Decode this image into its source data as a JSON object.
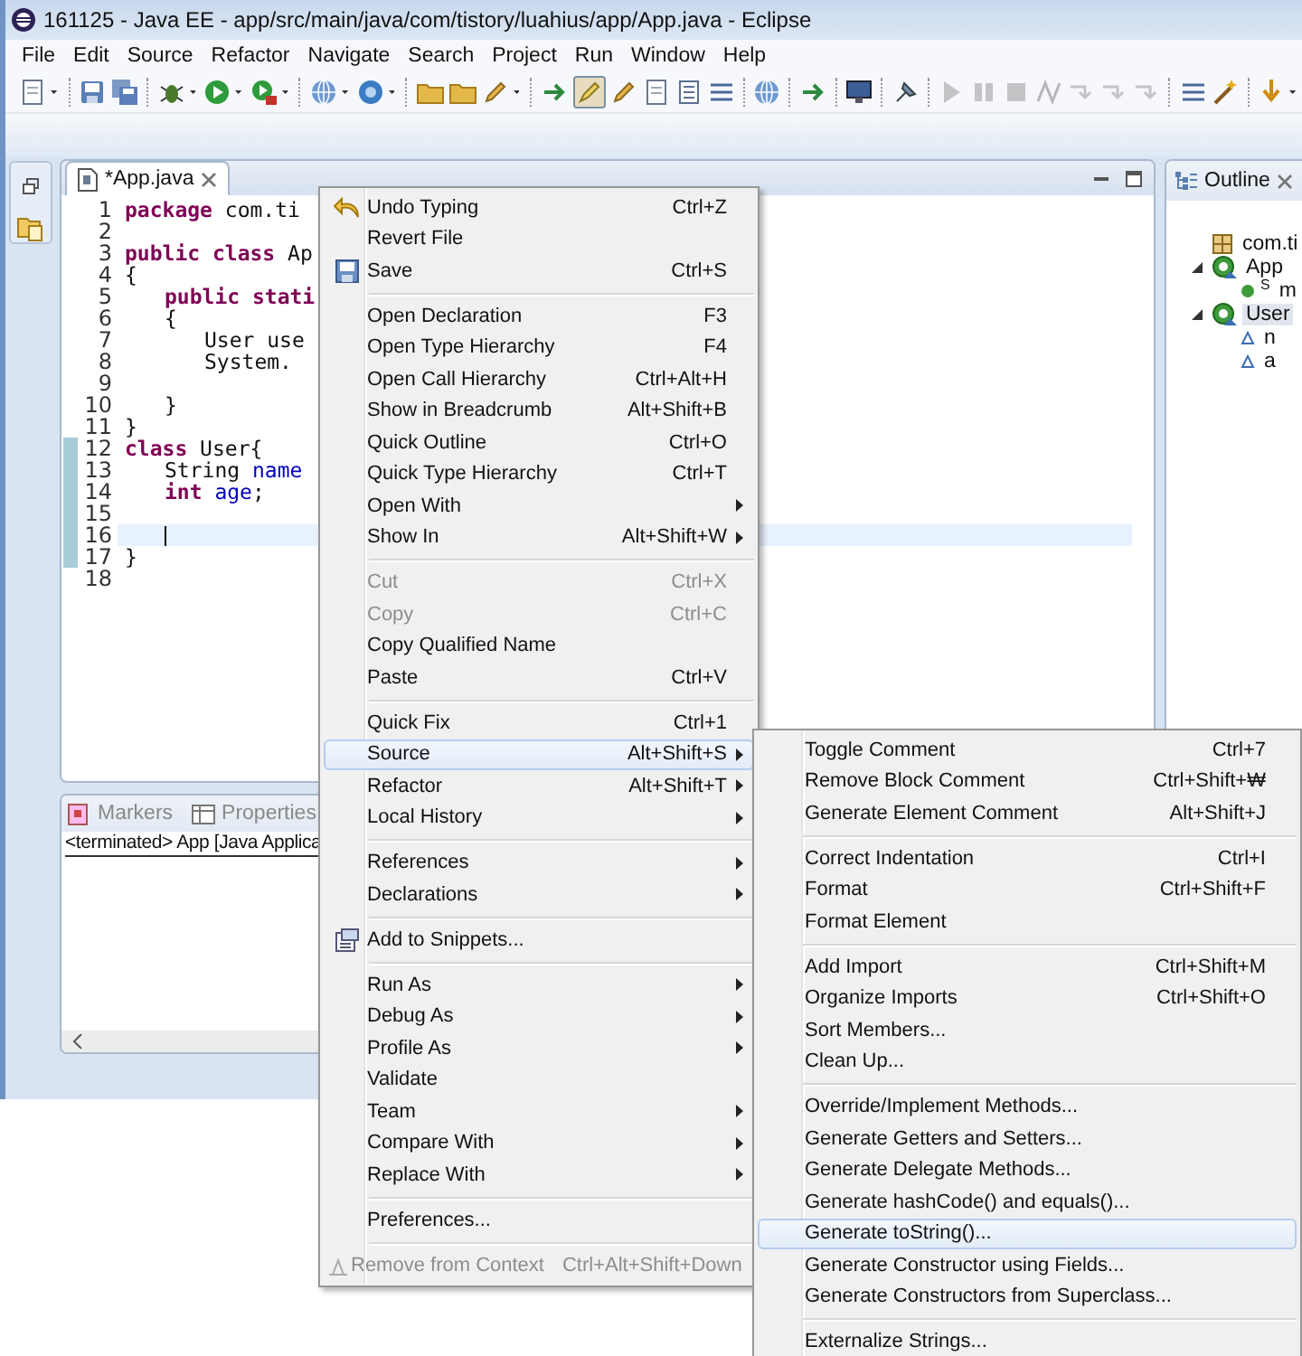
{
  "window": {
    "title": "161125 - Java EE - app/src/main/java/com/tistory/luahius/app/App.java - Eclipse"
  },
  "menubar": [
    "File",
    "Edit",
    "Source",
    "Refactor",
    "Navigate",
    "Search",
    "Project",
    "Run",
    "Window",
    "Help"
  ],
  "toolbar": [
    {
      "pressed": false,
      "disabled": false
    },
    {
      "pressed": false,
      "disabled": false
    },
    {
      "pressed": false,
      "disabled": false
    },
    {
      "pressed": false,
      "disabled": false
    },
    {
      "pressed": false,
      "disabled": false
    },
    {
      "pressed": false,
      "disabled": false
    },
    {
      "pressed": false,
      "disabled": false
    },
    {
      "pressed": false,
      "disabled": false
    },
    {
      "pressed": false,
      "disabled": false
    },
    {
      "pressed": false,
      "disabled": false
    },
    {
      "pressed": false,
      "disabled": false
    },
    {
      "pressed": false,
      "disabled": false
    },
    {
      "pressed": true,
      "disabled": false
    },
    {
      "pressed": false,
      "disabled": false
    },
    {
      "pressed": false,
      "disabled": false
    },
    {
      "pressed": false,
      "disabled": false
    },
    {
      "pressed": false,
      "disabled": false
    },
    {
      "pressed": false,
      "disabled": false
    },
    {
      "pressed": false,
      "disabled": false
    },
    {
      "pressed": false,
      "disabled": false
    },
    {
      "pressed": false,
      "disabled": false
    },
    {
      "pressed": false,
      "disabled": true
    },
    {
      "pressed": false,
      "disabled": true
    },
    {
      "pressed": false,
      "disabled": true
    },
    {
      "pressed": false,
      "disabled": true
    },
    {
      "pressed": false,
      "disabled": true
    },
    {
      "pressed": false,
      "disabled": true
    },
    {
      "pressed": false,
      "disabled": true
    },
    {
      "pressed": false,
      "disabled": false
    },
    {
      "pressed": false,
      "disabled": false
    },
    {
      "pressed": false,
      "disabled": false
    }
  ],
  "editor": {
    "tab": {
      "label": "*App.java",
      "selected": true
    },
    "lines": [
      {
        "number": "1",
        "changed": false,
        "current": false,
        "tokens": [
          {
            "text": "package",
            "kind": "keyword"
          },
          {
            "text": " com.ti",
            "kind": "plain"
          }
        ]
      },
      {
        "number": "2",
        "changed": false,
        "current": false
      },
      {
        "number": "3",
        "changed": false,
        "current": false,
        "tokens": [
          {
            "text": "public",
            "kind": "keyword"
          },
          {
            "text": " class",
            "kind": "keyword"
          },
          {
            "text": " Ap",
            "kind": "plain"
          }
        ]
      },
      {
        "number": "4",
        "changed": false,
        "current": false,
        "tokens": [
          {
            "text": "{",
            "kind": "plain"
          }
        ]
      },
      {
        "number": "5",
        "changed": false,
        "current": false,
        "tokens": [
          {
            "text": "\tpublic",
            "kind": "keyword"
          },
          {
            "text": " stati",
            "kind": "keyword"
          }
        ]
      },
      {
        "number": "6",
        "changed": false,
        "current": false,
        "tokens": [
          {
            "text": "\t{",
            "kind": "plain"
          }
        ]
      },
      {
        "number": "7",
        "changed": false,
        "current": false,
        "tokens": [
          {
            "text": "\t\tUser use",
            "kind": "plain"
          }
        ]
      },
      {
        "number": "8",
        "changed": false,
        "current": false,
        "tokens": [
          {
            "text": "\t\tSystem.",
            "kind": "plain"
          }
        ]
      },
      {
        "number": "9",
        "changed": false,
        "current": false
      },
      {
        "number": "10",
        "changed": false,
        "current": false,
        "tokens": [
          {
            "text": "\t}",
            "kind": "plain"
          }
        ]
      },
      {
        "number": "11",
        "changed": false,
        "current": false,
        "tokens": [
          {
            "text": "}",
            "kind": "plain"
          }
        ]
      },
      {
        "number": "12",
        "changed": true,
        "current": false,
        "tokens": [
          {
            "text": "class",
            "kind": "keyword"
          },
          {
            "text": " User{",
            "kind": "plain"
          }
        ]
      },
      {
        "number": "13",
        "changed": true,
        "current": false,
        "tokens": [
          {
            "text": "\tString ",
            "kind": "plain"
          },
          {
            "text": "name",
            "kind": "field"
          }
        ]
      },
      {
        "number": "14",
        "changed": true,
        "current": false,
        "tokens": [
          {
            "text": "\tint",
            "kind": "keyword"
          },
          {
            "text": " age",
            "kind": "field"
          },
          {
            "text": ";",
            "kind": "plain"
          }
        ]
      },
      {
        "number": "15",
        "changed": true,
        "current": false
      },
      {
        "number": "16",
        "changed": true,
        "current": true,
        "caret": true
      },
      {
        "number": "17",
        "changed": true,
        "current": false,
        "tokens": [
          {
            "text": "}",
            "kind": "plain"
          }
        ]
      },
      {
        "number": "18",
        "changed": false,
        "current": false
      }
    ]
  },
  "bottom_panel": {
    "tabs": [
      {
        "label": "Markers"
      },
      {
        "label": "Properties"
      }
    ],
    "header": "<terminated> App [Java Applica"
  },
  "outline": {
    "title": "Outline",
    "tree": [
      {
        "label": "com.ti",
        "kind": "package",
        "selected": false
      },
      {
        "label": "App",
        "kind": "class",
        "selected": false,
        "expanded": true,
        "children": [
          {
            "label": "m",
            "kind": "method",
            "badge": "S",
            "selected": false
          }
        ]
      },
      {
        "label": "User",
        "kind": "class",
        "selected": true,
        "expanded": true,
        "children": [
          {
            "label": "n",
            "kind": "field",
            "selected": false
          },
          {
            "label": "a",
            "kind": "field",
            "selected": false
          }
        ]
      }
    ]
  },
  "context_menu": {
    "groups": [
      {
        "items": [
          {
            "label": "Undo Typing",
            "shortcut": "Ctrl+Z",
            "submenu": false,
            "selected": false,
            "disabled": false
          },
          {
            "label": "Revert File",
            "submenu": false,
            "selected": false,
            "disabled": false
          },
          {
            "label": "Save",
            "shortcut": "Ctrl+S",
            "submenu": false,
            "selected": false,
            "disabled": false
          }
        ]
      },
      {
        "items": [
          {
            "label": "Open Declaration",
            "shortcut": "F3",
            "submenu": false,
            "selected": false,
            "disabled": false
          },
          {
            "label": "Open Type Hierarchy",
            "shortcut": "F4",
            "submenu": false,
            "selected": false,
            "disabled": false
          },
          {
            "label": "Open Call Hierarchy",
            "shortcut": "Ctrl+Alt+H",
            "submenu": false,
            "selected": false,
            "disabled": false
          },
          {
            "label": "Show in Breadcrumb",
            "shortcut": "Alt+Shift+B",
            "submenu": false,
            "selected": false,
            "disabled": false
          },
          {
            "label": "Quick Outline",
            "shortcut": "Ctrl+O",
            "submenu": false,
            "selected": false,
            "disabled": false
          },
          {
            "label": "Quick Type Hierarchy",
            "shortcut": "Ctrl+T",
            "submenu": false,
            "selected": false,
            "disabled": false
          },
          {
            "label": "Open With",
            "submenu": true,
            "selected": false,
            "disabled": false
          },
          {
            "label": "Show In",
            "shortcut": "Alt+Shift+W",
            "submenu": true,
            "selected": false,
            "disabled": false
          }
        ]
      },
      {
        "items": [
          {
            "label": "Cut",
            "shortcut": "Ctrl+X",
            "submenu": false,
            "selected": false,
            "disabled": true
          },
          {
            "label": "Copy",
            "shortcut": "Ctrl+C",
            "submenu": false,
            "selected": false,
            "disabled": true
          },
          {
            "label": "Copy Qualified Name",
            "submenu": false,
            "selected": false,
            "disabled": false
          },
          {
            "label": "Paste",
            "shortcut": "Ctrl+V",
            "submenu": false,
            "selected": false,
            "disabled": false
          }
        ]
      },
      {
        "items": [
          {
            "label": "Quick Fix",
            "shortcut": "Ctrl+1",
            "submenu": false,
            "selected": false,
            "disabled": false
          },
          {
            "label": "Source",
            "shortcut": "Alt+Shift+S",
            "submenu": true,
            "selected": true,
            "disabled": false
          },
          {
            "label": "Refactor",
            "shortcut": "Alt+Shift+T",
            "submenu": true,
            "selected": false,
            "disabled": false
          },
          {
            "label": "Local History",
            "submenu": true,
            "selected": false,
            "disabled": false
          }
        ]
      },
      {
        "items": [
          {
            "label": "References",
            "submenu": true,
            "selected": false,
            "disabled": false
          },
          {
            "label": "Declarations",
            "submenu": true,
            "selected": false,
            "disabled": false
          }
        ]
      },
      {
        "items": [
          {
            "label": "Add to Snippets...",
            "submenu": false,
            "selected": false,
            "disabled": false
          }
        ]
      },
      {
        "items": [
          {
            "label": "Run As",
            "submenu": true,
            "selected": false,
            "disabled": false
          },
          {
            "label": "Debug As",
            "submenu": true,
            "selected": false,
            "disabled": false
          },
          {
            "label": "Profile As",
            "submenu": true,
            "selected": false,
            "disabled": false
          },
          {
            "label": "Validate",
            "submenu": false,
            "selected": false,
            "disabled": false
          },
          {
            "label": "Team",
            "submenu": true,
            "selected": false,
            "disabled": false
          },
          {
            "label": "Compare With",
            "submenu": true,
            "selected": false,
            "disabled": false
          },
          {
            "label": "Replace With",
            "submenu": true,
            "selected": false,
            "disabled": false
          }
        ]
      },
      {
        "items": [
          {
            "label": "Preferences...",
            "submenu": false,
            "selected": false,
            "disabled": false
          }
        ]
      },
      {
        "items": [
          {
            "label": "Remove from Context",
            "shortcut": "Ctrl+Alt+Shift+Down",
            "submenu": false,
            "selected": false,
            "disabled": true
          }
        ]
      }
    ]
  },
  "submenu": {
    "groups": [
      {
        "items": [
          {
            "label": "Toggle Comment",
            "shortcut": "Ctrl+7",
            "selected": false
          },
          {
            "label": "Remove Block Comment",
            "shortcut": "Ctrl+Shift+₩",
            "selected": false
          },
          {
            "label": "Generate Element Comment",
            "shortcut": "Alt+Shift+J",
            "selected": false
          }
        ]
      },
      {
        "items": [
          {
            "label": "Correct Indentation",
            "shortcut": "Ctrl+I",
            "selected": false
          },
          {
            "label": "Format",
            "shortcut": "Ctrl+Shift+F",
            "selected": false
          },
          {
            "label": "Format Element",
            "selected": false
          }
        ]
      },
      {
        "items": [
          {
            "label": "Add Import",
            "shortcut": "Ctrl+Shift+M",
            "selected": false
          },
          {
            "label": "Organize Imports",
            "shortcut": "Ctrl+Shift+O",
            "selected": false
          },
          {
            "label": "Sort Members...",
            "selected": false
          },
          {
            "label": "Clean Up...",
            "selected": false
          }
        ]
      },
      {
        "items": [
          {
            "label": "Override/Implement Methods...",
            "selected": false
          },
          {
            "label": "Generate Getters and Setters...",
            "selected": false
          },
          {
            "label": "Generate Delegate Methods...",
            "selected": false
          },
          {
            "label": "Generate hashCode() and equals()...",
            "selected": false
          },
          {
            "label": "Generate toString()...",
            "selected": true
          },
          {
            "label": "Generate Constructor using Fields...",
            "selected": false
          },
          {
            "label": "Generate Constructors from Superclass...",
            "selected": false
          }
        ]
      },
      {
        "items": [
          {
            "label": "Externalize Strings...",
            "selected": false
          }
        ]
      }
    ]
  }
}
